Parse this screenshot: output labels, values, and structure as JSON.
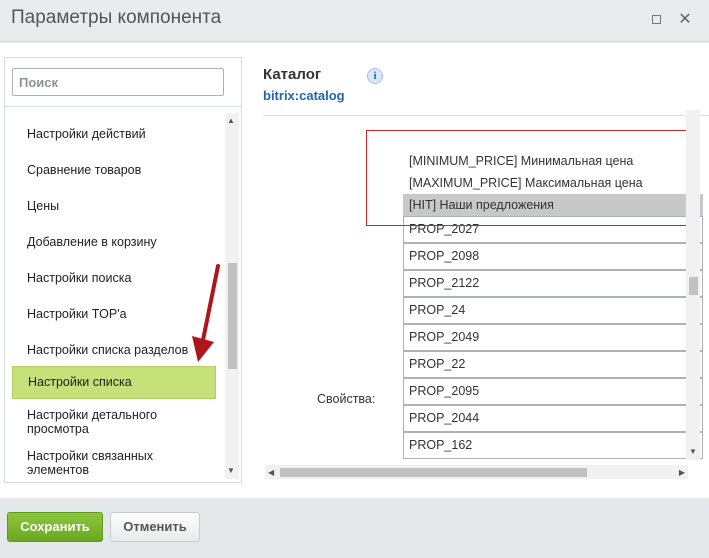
{
  "window": {
    "title": "Параметры компонента",
    "maximize_icon": "maximize-icon",
    "close_icon": "close-icon",
    "close_glyph": "✕"
  },
  "sidebar": {
    "search_placeholder": "Поиск",
    "items": [
      {
        "label": "Настройки действий"
      },
      {
        "label": "Сравнение товаров"
      },
      {
        "label": "Цены"
      },
      {
        "label": "Добавление в корзину"
      },
      {
        "label": "Настройки поиска"
      },
      {
        "label": "Настройки TOP'a"
      },
      {
        "label": "Настройки списка разделов"
      },
      {
        "label": "Настройки списка"
      },
      {
        "label": "Настройки детального просмотра"
      },
      {
        "label": "Настройки связанных элементов"
      }
    ],
    "active_item": "Настройки списка"
  },
  "component": {
    "title": "Каталог",
    "code": "bitrix:catalog",
    "info_glyph": "i"
  },
  "properties": {
    "label": "Свойства:",
    "options_top": [
      {
        "text": "[MINIMUM_PRICE] Минимальная цена",
        "selected": false
      },
      {
        "text": "[MAXIMUM_PRICE] Максимальная цена",
        "selected": false
      },
      {
        "text": "[HIT] Наши предложения",
        "selected": true
      }
    ],
    "options": [
      "PROP_2027",
      "PROP_2098",
      "PROP_2122",
      "PROP_24",
      "PROP_2049",
      "PROP_22",
      "PROP_2095",
      "PROP_2044",
      "PROP_162"
    ]
  },
  "footer": {
    "save_label": "Сохранить",
    "cancel_label": "Отменить"
  },
  "colors": {
    "active_item_bg": "#c6e07a",
    "save_button": "#7ab82e",
    "highlight_frame": "#c0282e",
    "annotation_arrow": "#b0141c",
    "link": "#2067b0"
  }
}
